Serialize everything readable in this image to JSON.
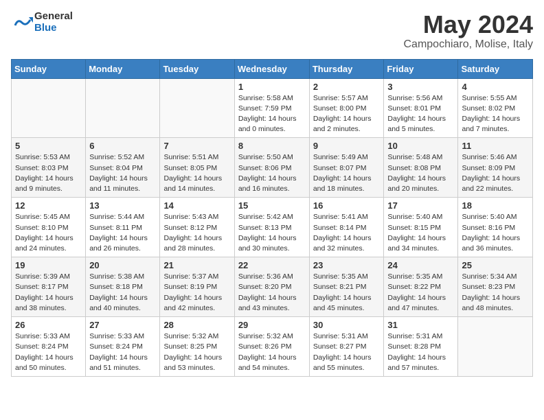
{
  "header": {
    "logo_general": "General",
    "logo_blue": "Blue",
    "month_title": "May 2024",
    "location": "Campochiaro, Molise, Italy"
  },
  "days_of_week": [
    "Sunday",
    "Monday",
    "Tuesday",
    "Wednesday",
    "Thursday",
    "Friday",
    "Saturday"
  ],
  "weeks": [
    [
      {
        "day": "",
        "content": ""
      },
      {
        "day": "",
        "content": ""
      },
      {
        "day": "",
        "content": ""
      },
      {
        "day": "1",
        "content": "Sunrise: 5:58 AM\nSunset: 7:59 PM\nDaylight: 14 hours\nand 0 minutes."
      },
      {
        "day": "2",
        "content": "Sunrise: 5:57 AM\nSunset: 8:00 PM\nDaylight: 14 hours\nand 2 minutes."
      },
      {
        "day": "3",
        "content": "Sunrise: 5:56 AM\nSunset: 8:01 PM\nDaylight: 14 hours\nand 5 minutes."
      },
      {
        "day": "4",
        "content": "Sunrise: 5:55 AM\nSunset: 8:02 PM\nDaylight: 14 hours\nand 7 minutes."
      }
    ],
    [
      {
        "day": "5",
        "content": "Sunrise: 5:53 AM\nSunset: 8:03 PM\nDaylight: 14 hours\nand 9 minutes."
      },
      {
        "day": "6",
        "content": "Sunrise: 5:52 AM\nSunset: 8:04 PM\nDaylight: 14 hours\nand 11 minutes."
      },
      {
        "day": "7",
        "content": "Sunrise: 5:51 AM\nSunset: 8:05 PM\nDaylight: 14 hours\nand 14 minutes."
      },
      {
        "day": "8",
        "content": "Sunrise: 5:50 AM\nSunset: 8:06 PM\nDaylight: 14 hours\nand 16 minutes."
      },
      {
        "day": "9",
        "content": "Sunrise: 5:49 AM\nSunset: 8:07 PM\nDaylight: 14 hours\nand 18 minutes."
      },
      {
        "day": "10",
        "content": "Sunrise: 5:48 AM\nSunset: 8:08 PM\nDaylight: 14 hours\nand 20 minutes."
      },
      {
        "day": "11",
        "content": "Sunrise: 5:46 AM\nSunset: 8:09 PM\nDaylight: 14 hours\nand 22 minutes."
      }
    ],
    [
      {
        "day": "12",
        "content": "Sunrise: 5:45 AM\nSunset: 8:10 PM\nDaylight: 14 hours\nand 24 minutes."
      },
      {
        "day": "13",
        "content": "Sunrise: 5:44 AM\nSunset: 8:11 PM\nDaylight: 14 hours\nand 26 minutes."
      },
      {
        "day": "14",
        "content": "Sunrise: 5:43 AM\nSunset: 8:12 PM\nDaylight: 14 hours\nand 28 minutes."
      },
      {
        "day": "15",
        "content": "Sunrise: 5:42 AM\nSunset: 8:13 PM\nDaylight: 14 hours\nand 30 minutes."
      },
      {
        "day": "16",
        "content": "Sunrise: 5:41 AM\nSunset: 8:14 PM\nDaylight: 14 hours\nand 32 minutes."
      },
      {
        "day": "17",
        "content": "Sunrise: 5:40 AM\nSunset: 8:15 PM\nDaylight: 14 hours\nand 34 minutes."
      },
      {
        "day": "18",
        "content": "Sunrise: 5:40 AM\nSunset: 8:16 PM\nDaylight: 14 hours\nand 36 minutes."
      }
    ],
    [
      {
        "day": "19",
        "content": "Sunrise: 5:39 AM\nSunset: 8:17 PM\nDaylight: 14 hours\nand 38 minutes."
      },
      {
        "day": "20",
        "content": "Sunrise: 5:38 AM\nSunset: 8:18 PM\nDaylight: 14 hours\nand 40 minutes."
      },
      {
        "day": "21",
        "content": "Sunrise: 5:37 AM\nSunset: 8:19 PM\nDaylight: 14 hours\nand 42 minutes."
      },
      {
        "day": "22",
        "content": "Sunrise: 5:36 AM\nSunset: 8:20 PM\nDaylight: 14 hours\nand 43 minutes."
      },
      {
        "day": "23",
        "content": "Sunrise: 5:35 AM\nSunset: 8:21 PM\nDaylight: 14 hours\nand 45 minutes."
      },
      {
        "day": "24",
        "content": "Sunrise: 5:35 AM\nSunset: 8:22 PM\nDaylight: 14 hours\nand 47 minutes."
      },
      {
        "day": "25",
        "content": "Sunrise: 5:34 AM\nSunset: 8:23 PM\nDaylight: 14 hours\nand 48 minutes."
      }
    ],
    [
      {
        "day": "26",
        "content": "Sunrise: 5:33 AM\nSunset: 8:24 PM\nDaylight: 14 hours\nand 50 minutes."
      },
      {
        "day": "27",
        "content": "Sunrise: 5:33 AM\nSunset: 8:24 PM\nDaylight: 14 hours\nand 51 minutes."
      },
      {
        "day": "28",
        "content": "Sunrise: 5:32 AM\nSunset: 8:25 PM\nDaylight: 14 hours\nand 53 minutes."
      },
      {
        "day": "29",
        "content": "Sunrise: 5:32 AM\nSunset: 8:26 PM\nDaylight: 14 hours\nand 54 minutes."
      },
      {
        "day": "30",
        "content": "Sunrise: 5:31 AM\nSunset: 8:27 PM\nDaylight: 14 hours\nand 55 minutes."
      },
      {
        "day": "31",
        "content": "Sunrise: 5:31 AM\nSunset: 8:28 PM\nDaylight: 14 hours\nand 57 minutes."
      },
      {
        "day": "",
        "content": ""
      }
    ]
  ]
}
